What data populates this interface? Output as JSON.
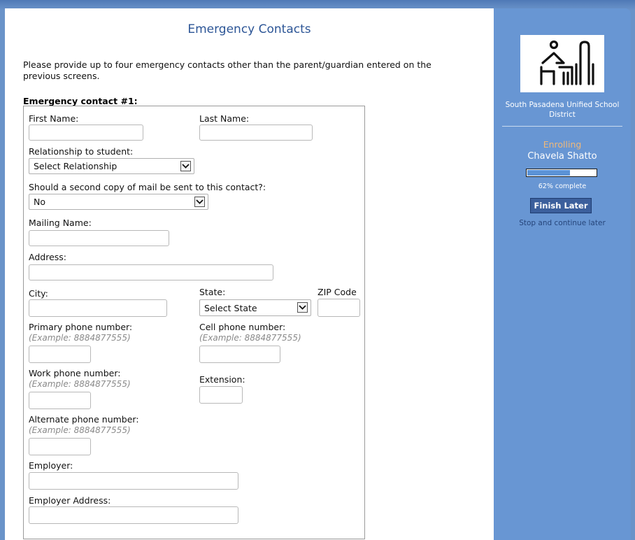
{
  "page": {
    "title": "Emergency Contacts",
    "intro": "Please provide up to four emergency contacts other than the parent/guardian entered on the previous screens.",
    "contact_heading": "Emergency contact #1:"
  },
  "form": {
    "first_name_label": "First Name:",
    "last_name_label": "Last Name:",
    "relationship_label": "Relationship to student:",
    "relationship_value": "Select Relationship",
    "second_copy_label": "Should a second copy of mail be sent to this contact?:",
    "second_copy_value": "No",
    "mailing_name_label": "Mailing Name:",
    "address_label": "Address:",
    "city_label": "City:",
    "state_label": "State:",
    "state_value": "Select State",
    "zip_label": "ZIP Code",
    "primary_phone_label": "Primary phone number:",
    "primary_phone_hint": "(Example: 8884877555)",
    "cell_phone_label": "Cell phone number:",
    "cell_phone_hint": "(Example: 8884877555)",
    "work_phone_label": "Work phone number:",
    "work_phone_hint": "(Example: 8884877555)",
    "extension_label": "Extension:",
    "alternate_phone_label": "Alternate phone number:",
    "alternate_phone_hint": "(Example: 8884877555)",
    "employer_label": "Employer:",
    "employer_address_label": "Employer Address:"
  },
  "sidebar": {
    "district": "South Pasadena Unified School District",
    "status": "Enrolling",
    "student_name": "Chavela Shatto",
    "progress_percent": 62,
    "progress_text": "62% complete",
    "finish_button": "Finish Later",
    "stop_link": "Stop and continue later",
    "logo_icon": "student-desk-logo"
  },
  "colors": {
    "title": "#2c5596",
    "sidebar_bg": "#6896d3",
    "enrolling": "#f0b97a",
    "button": "#3b5f9c"
  }
}
